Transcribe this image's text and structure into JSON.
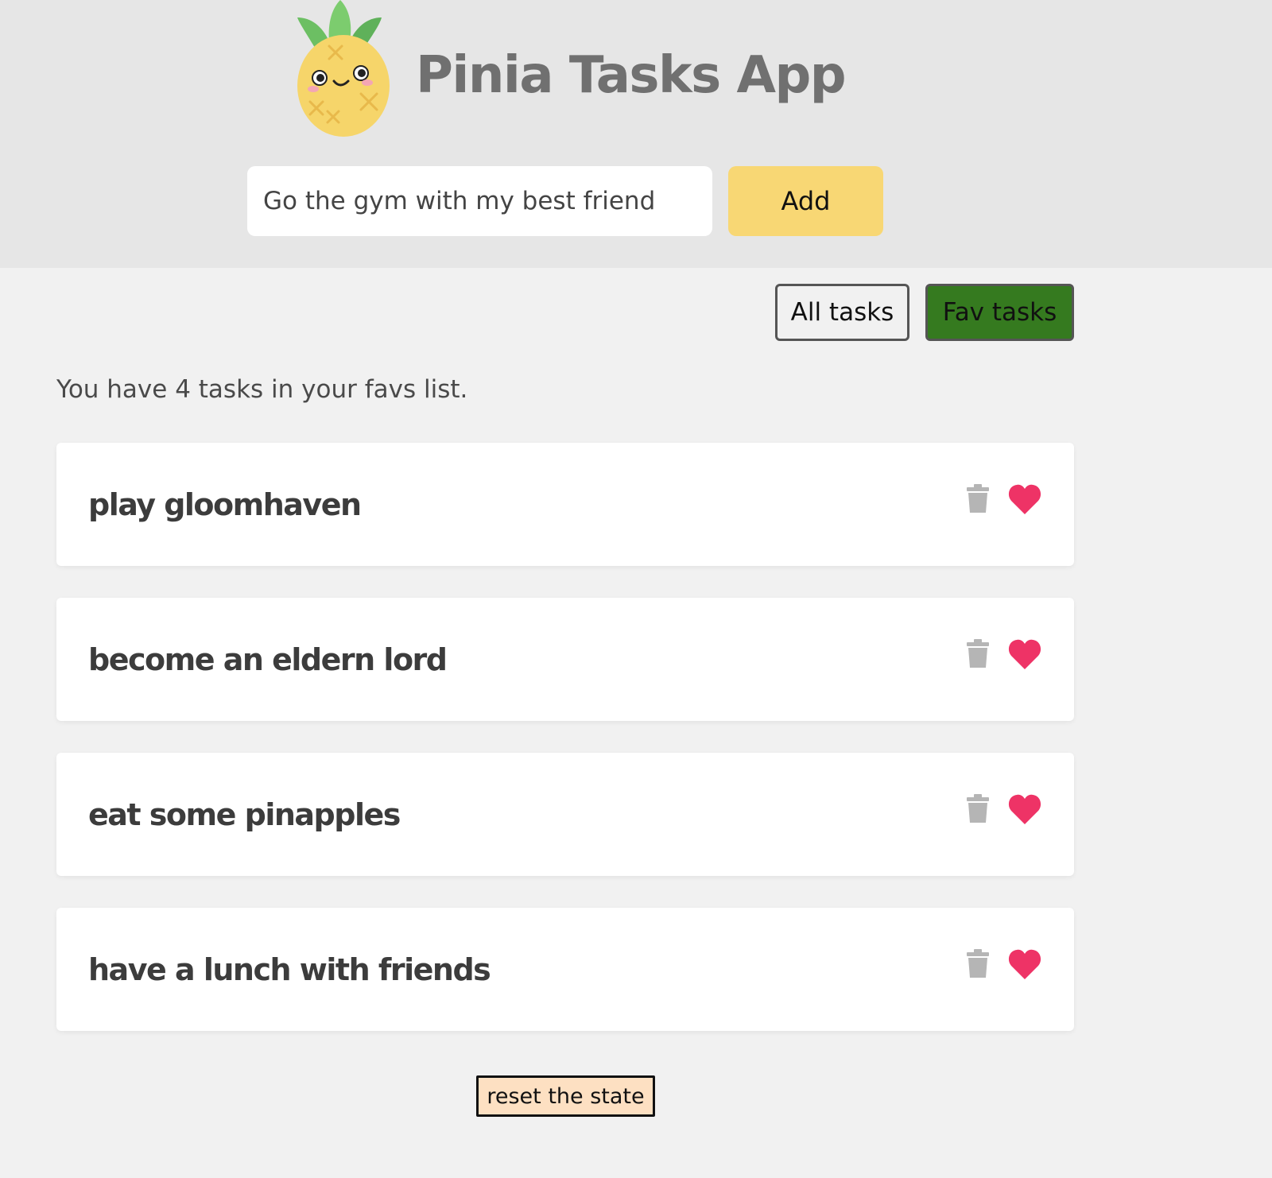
{
  "header": {
    "title": "Pinia Tasks App",
    "logo_icon": "pineapple-mascot-icon"
  },
  "new_task_form": {
    "input_value": "Go the gym with my best friend",
    "add_label": "Add"
  },
  "filters": {
    "all_label": "All tasks",
    "fav_label": "Fav tasks",
    "active": "fav"
  },
  "summary": "You have 4 tasks in your favs list.",
  "tasks": [
    {
      "title": "play gloomhaven",
      "is_fav": true
    },
    {
      "title": "become an eldern lord",
      "is_fav": true
    },
    {
      "title": "eat some pinapples",
      "is_fav": true
    },
    {
      "title": "have a lunch with friends",
      "is_fav": true
    }
  ],
  "icons": {
    "delete": "trash-icon",
    "favorite": "heart-icon"
  },
  "reset_label": "reset the state",
  "colors": {
    "header_bg": "#e6e6e6",
    "page_bg": "#f1f1f1",
    "add_button": "#f8d774",
    "fav_active": "#357a1f",
    "heart": "#ee3366",
    "trash": "#b5b5b5",
    "reset_bg": "#fde0c2"
  }
}
